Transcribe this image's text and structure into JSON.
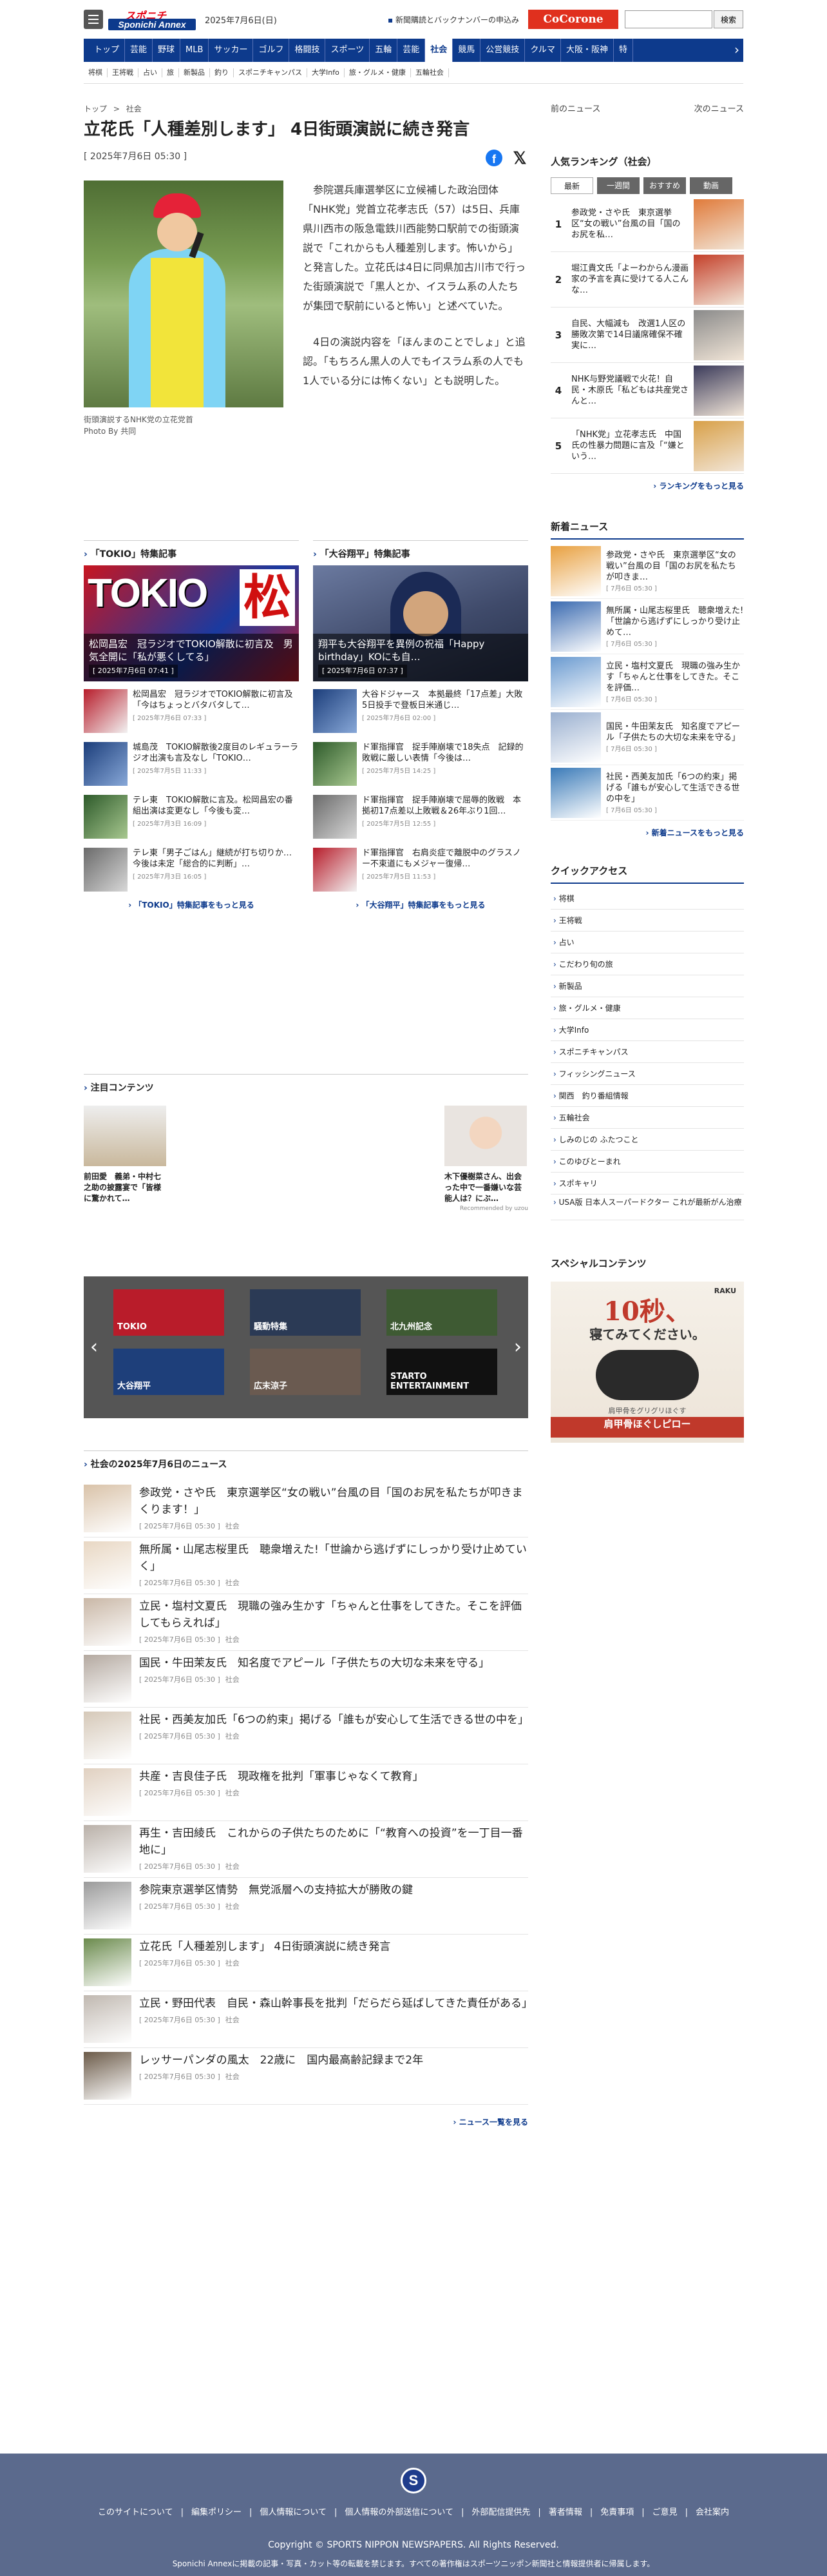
{
  "header": {
    "logo_top": "スポニチ",
    "logo_main": "Sponichi Annex",
    "date": "2025年7月6日(日)",
    "promo": "新聞購読とバックナンバーの申込み",
    "cocorone": "CoCorone",
    "search_button": "検索",
    "search_placeholder": ""
  },
  "gnav": [
    "トップ",
    "芸能",
    "野球",
    "MLB",
    "サッカー",
    "ゴルフ",
    "格闘技",
    "スポーツ",
    "五輪",
    "芸能",
    "社会",
    "競馬",
    "公営競技",
    "クルマ",
    "大阪・阪神",
    "特"
  ],
  "gnav_active": "社会",
  "subnav": [
    "将棋",
    "王将戦",
    "占い",
    "旅",
    "新製品",
    "釣り",
    "スポニチキャンパス",
    "大学Info",
    "旅・グルメ・健康",
    "五輪社会"
  ],
  "breadcrumb": [
    "トップ",
    ">",
    "社会"
  ],
  "article": {
    "headline": "立花氏「人種差別します」 4日街頭演説に続き発言",
    "date": "[ 2025年7月6日 05:30 ]",
    "photo_caption": "街頭演説するNHK党の立花党首",
    "photo_credit": "Photo By 共同",
    "para1": "参院選兵庫選挙区に立候補した政治団体「NHK党」党首立花孝志氏（57）は5日、兵庫県川西市の阪急電鉄川西能勢口駅前での街頭演説で「これからも人種差別します。怖いから」と発言した。立花氏は4日に同県加古川市で行った街頭演説で「黒人とか、イスラム系の人たちが集団で駅前にいると怖い」と述べていた。",
    "para2": "4日の演説内容を「ほんまのことでしょ」と追認。「もちろん黒人の人でもイスラム系の人でも1人でいる分には怖くない」とも説明した。"
  },
  "special": [
    {
      "title": "「TOKIO」特集記事",
      "feature": "松岡昌宏　冠ラジオでTOKIO解散に初言及　男気全開に「私が悪くしてる」",
      "feature_date": "[ 2025年7月6日 07:41 ]",
      "items": [
        {
          "text": "松岡昌宏　冠ラジオでTOKIO解散に初言及「今はちょっとバタバタして…",
          "date": "[ 2025年7月6日 07:33 ]"
        },
        {
          "text": "城島茂　TOKIO解散後2度目のレギュラーラジオ出演も言及なし「TOKIO…",
          "date": "[ 2025年7月5日 11:33 ]"
        },
        {
          "text": "テレ東　TOKIO解散に言及。松岡昌宏の番組出演は変更なし「今後も変…",
          "date": "[ 2025年7月3日 16:09 ]"
        },
        {
          "text": "テレ東「男子ごはん」継続が打ち切りか…今後は未定「総合的に判断」…",
          "date": "[ 2025年7月3日 16:05 ]"
        }
      ],
      "more": "「TOKIO」特集記事をもっと見る"
    },
    {
      "title": "「大谷翔平」特集記事",
      "feature": "翔平も大谷翔平を異例の祝福「Happy birthday」KOにも自…",
      "feature_date": "[ 2025年7月6日 07:37 ]",
      "items": [
        {
          "text": "大谷ドジャース　本拠最終「17点差」大敗　5日投手で登板日米通じ…",
          "date": "[ 2025年7月6日 02:00 ]"
        },
        {
          "text": "ド軍指揮官　捉手陣崩壊で18失点　記録的敗戦に厳しい表情「今後は…",
          "date": "[ 2025年7月5日 14:25 ]"
        },
        {
          "text": "ド軍指揮官　捉手陣崩壊で屈辱的敗戦　本拠初17点差以上敗戦＆26年ぶり1回…",
          "date": "[ 2025年7月5日 12:55 ]"
        },
        {
          "text": "ド軍指揮官　右肩炎症で離脱中のグラスノー不束道にもメジャー復帰…",
          "date": "[ 2025年7月5日 11:53 ]"
        }
      ],
      "more": "「大谷翔平」特集記事をもっと見る"
    }
  ],
  "attention": {
    "title": "注目コンテンツ",
    "cards": [
      {
        "text": "前田愛　義弟・中村七之助の披露宴で「皆様に驚かれて…"
      },
      {
        "text": "木下優樹菜さん、出会った中で一番嫌いな芸能人は？にぶ…"
      }
    ],
    "recommended": "Recommended by uzou"
  },
  "carousel": [
    "TOKIO",
    "騒動特集",
    "北九州記念",
    "大谷翔平",
    "広末涼子",
    "STARTO ENTERTAINMENT"
  ],
  "daynews": {
    "title": "社会の2025年7月6日のニュース",
    "items": [
      {
        "text": "参政党・さや氏　東京選挙区“女の戦い”台風の目「国のお尻を私たちが叩きまくります！」",
        "date": "[ 2025年7月6日 05:30 ]",
        "cat": "社会"
      },
      {
        "text": "無所属・山尾志桜里氏　聴衆増えた!「世論から逃げずにしっかり受け止めていく」",
        "date": "[ 2025年7月6日 05:30 ]",
        "cat": "社会"
      },
      {
        "text": "立民・塩村文夏氏　現職の強み生かす「ちゃんと仕事をしてきた。そこを評価してもらえれば」",
        "date": "[ 2025年7月6日 05:30 ]",
        "cat": "社会"
      },
      {
        "text": "国民・牛田茉友氏　知名度でアピール「子供たちの大切な未来を守る」",
        "date": "[ 2025年7月6日 05:30 ]",
        "cat": "社会"
      },
      {
        "text": "社民・西美友加氏「6つの約束」掲げる「誰もが安心して生活できる世の中を」",
        "date": "[ 2025年7月6日 05:30 ]",
        "cat": "社会"
      },
      {
        "text": "共産・吉良佳子氏　現政権を批判「軍事じゃなくて教育」",
        "date": "[ 2025年7月6日 05:30 ]",
        "cat": "社会"
      },
      {
        "text": "再生・吉田綾氏　これからの子供たちのために「“教育への投資”を一丁目一番地に」",
        "date": "[ 2025年7月6日 05:30 ]",
        "cat": "社会"
      },
      {
        "text": "参院東京選挙区情勢　無党派層への支持拡大が勝敗の鍵",
        "date": "[ 2025年7月6日 05:30 ]",
        "cat": "社会"
      },
      {
        "text": "立花氏「人種差別します」 4日街頭演説に続き発言",
        "date": "[ 2025年7月6日 05:30 ]",
        "cat": "社会"
      },
      {
        "text": "立民・野田代表　自民・森山幹事長を批判「だらだら延ばしてきた責任がある」",
        "date": "[ 2025年7月6日 05:30 ]",
        "cat": "社会"
      },
      {
        "text": "レッサーパンダの風太　22歳に　国内最高齢記録まで2年",
        "date": "[ 2025年7月6日 05:30 ]",
        "cat": "社会"
      }
    ],
    "more": "ニュース一覧を見る"
  },
  "sidebar": {
    "prev": "前のニュース",
    "next": "次のニュース",
    "ranking_title": "人気ランキング（社会）",
    "ranking_tabs": [
      "最新",
      "一週間",
      "おすすめ",
      "動画"
    ],
    "ranking": [
      {
        "n": "1",
        "text": "参政党・さや氏　東京選挙区“女の戦い”台風の目「国のお尻を私…"
      },
      {
        "n": "2",
        "text": "堀江貴文氏「よーわからん漫画家の予言を真に受けてる人こんな…"
      },
      {
        "n": "3",
        "text": "自民、大幅減も　改選1人区の勝敗次第で14日議席確保不確実に…"
      },
      {
        "n": "4",
        "text": "NHK与野党議戦で火花！自民・木原氏「私どもは共産党さんと…"
      },
      {
        "n": "5",
        "text": "「NHK党」立花孝志氏　中国氏の性暴力問題に言及「“嫌という…"
      }
    ],
    "ranking_more": "ランキングをもっと見る",
    "newnews_title": "新着ニュース",
    "newnews": [
      {
        "text": "参政党・さや氏　東京選挙区“女の戦い”台風の目「国のお尻を私たちが叩きま…",
        "date": "[ 7月6日 05:30 ]"
      },
      {
        "text": "無所属・山尾志桜里氏　聴衆増えた!「世論から逃げずにしっかり受け止めて…",
        "date": "[ 7月6日 05:30 ]"
      },
      {
        "text": "立民・塩村文夏氏　現職の強み生かす「ちゃんと仕事をしてきた。そこを評価…",
        "date": "[ 7月6日 05:30 ]"
      },
      {
        "text": "国民・牛田茉友氏　知名度でアピール「子供たちの大切な未来を守る」",
        "date": "[ 7月6日 05:30 ]"
      },
      {
        "text": "社民・西美友加氏「6つの約束」掲げる「誰もが安心して生活できる世の中を」",
        "date": "[ 7月6日 05:30 ]"
      }
    ],
    "newnews_more": "新着ニュースをもっと見る",
    "quick_title": "クイックアクセス",
    "quick": [
      "将棋",
      "王将戦",
      "占い",
      "こだわり旬の旅",
      "新製品",
      "旅・グルメ・健康",
      "大学Info",
      "スポニチキャンパス",
      "フィッシングニュース",
      "関西　釣り番組情報",
      "五輪社会",
      "しみのじの ふたつこと",
      "このゆびとーまれ",
      "スポキャリ",
      "USA版 日本人スーパードクター これが最新がん治療"
    ],
    "special_title": "スペシャルコンテンツ",
    "ad_top": "RAKU",
    "ad_big": "10秒、",
    "ad_line": "寝てみてください。",
    "ad_sub": "肩甲骨をグリグリほぐす",
    "ad_product": "肩甲骨ほぐしピロー"
  },
  "footer": {
    "links": [
      "このサイトについて",
      "編集ポリシー",
      "個人情報について",
      "個人情報の外部送信について",
      "外部配信提供先",
      "著者情報",
      "免責事項",
      "ご意見",
      "会社案内"
    ],
    "copyright": "Copyright © SPORTS NIPPON NEWSPAPERS. All Rights Reserved.",
    "note": "Sponichi Annexに掲載の記事・写真・カット等の転載を禁じます。すべての著作権はスポーツニッポン新聞社と情報提供者に帰属します。"
  }
}
